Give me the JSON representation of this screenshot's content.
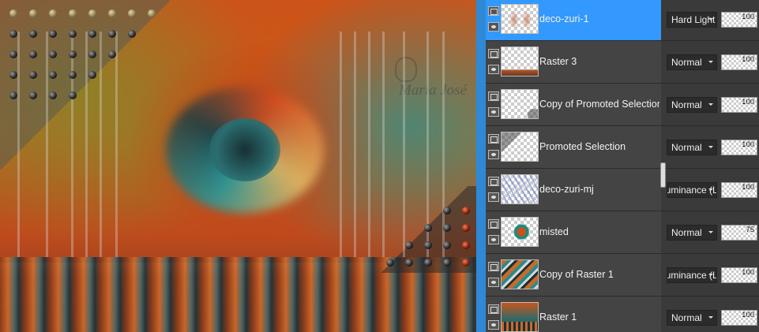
{
  "canvas": {
    "watermark": "Maria José"
  },
  "layers": [
    {
      "name": "deco-zuri-1",
      "blend": "Hard Light",
      "opacity": "100",
      "selected": true,
      "thumb": "t-deco1",
      "cut": false
    },
    {
      "name": "Raster 3",
      "blend": "Normal",
      "opacity": "100",
      "selected": false,
      "thumb": "t-raster3",
      "cut": false
    },
    {
      "name": "Copy of Promoted Selection",
      "blend": "Normal",
      "opacity": "100",
      "selected": false,
      "thumb": "t-copysel",
      "cut": false
    },
    {
      "name": "Promoted Selection",
      "blend": "Normal",
      "opacity": "100",
      "selected": false,
      "thumb": "t-promsel",
      "cut": false
    },
    {
      "name": "deco-zuri-mj",
      "blend": "Luminance (L)",
      "opacity": "100",
      "selected": false,
      "thumb": "t-decomj",
      "cut": true
    },
    {
      "name": "misted",
      "blend": "Normal",
      "opacity": "75",
      "selected": false,
      "thumb": "t-misted",
      "cut": false
    },
    {
      "name": "Copy of Raster 1",
      "blend": "Luminance (L)",
      "opacity": "100",
      "selected": false,
      "thumb": "t-copyr1",
      "cut": true
    },
    {
      "name": "Raster 1",
      "blend": "Normal",
      "opacity": "100",
      "selected": false,
      "thumb": "t-raster1",
      "cut": false
    }
  ],
  "colors": {
    "selection": "#3399ff",
    "panel_bg": "#3c3c3c",
    "divider": "#2f89d6"
  },
  "icons": {
    "visibility": "eye-icon",
    "mask": "layer-mode-icon",
    "dropdown": "chevron-down-icon"
  }
}
